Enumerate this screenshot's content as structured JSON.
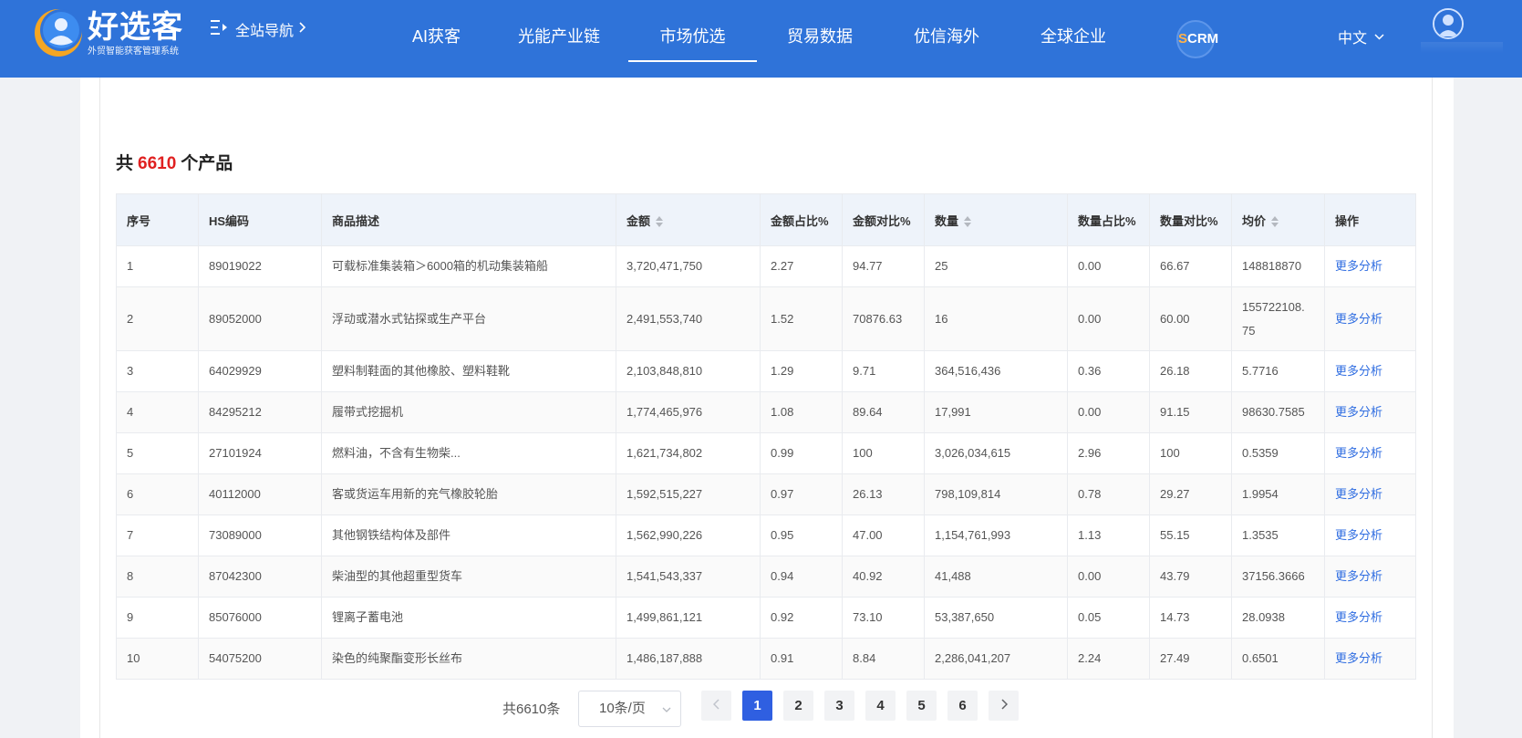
{
  "header": {
    "logo_name": "好选客",
    "logo_sub": "外贸智能获客管理系统",
    "site_nav": "全站导航",
    "nav": [
      {
        "label": "AI获客",
        "active": false
      },
      {
        "label": "光能产业链",
        "active": false
      },
      {
        "label": "市场优选",
        "active": true
      },
      {
        "label": "贸易数据",
        "active": false
      },
      {
        "label": "优信海外",
        "active": false
      },
      {
        "label": "全球企业",
        "active": false
      }
    ],
    "scrm_first": "S",
    "scrm_rest": "CRM",
    "language": "中文"
  },
  "summary": {
    "prefix": "共",
    "count": "6610",
    "suffix": "个产品"
  },
  "table": {
    "columns": [
      "序号",
      "HS编码",
      "商品描述",
      "金额",
      "金额占比%",
      "金额对比%",
      "数量",
      "数量占比%",
      "数量对比%",
      "均价",
      "操作"
    ],
    "rows": [
      {
        "no": "1",
        "hs": "89019022",
        "desc": "可载标准集装箱＞6000箱的机动集装箱船",
        "amount": "3,720,471,750",
        "amount_pct": "2.27",
        "amount_cmp": "94.77",
        "qty": "25",
        "qty_pct": "0.00",
        "qty_cmp": "66.67",
        "avg": "148818870",
        "action": "更多分析"
      },
      {
        "no": "2",
        "hs": "89052000",
        "desc": "浮动或潜水式钻探或生产平台",
        "amount": "2,491,553,740",
        "amount_pct": "1.52",
        "amount_cmp": "70876.63",
        "qty": "16",
        "qty_pct": "0.00",
        "qty_cmp": "60.00",
        "avg_line1": "155722108.",
        "avg_line2": "75",
        "action": "更多分析"
      },
      {
        "no": "3",
        "hs": "64029929",
        "desc": "塑料制鞋面的其他橡胶、塑料鞋靴",
        "amount": "2,103,848,810",
        "amount_pct": "1.29",
        "amount_cmp": "9.71",
        "qty": "364,516,436",
        "qty_pct": "0.36",
        "qty_cmp": "26.18",
        "avg": "5.7716",
        "action": "更多分析"
      },
      {
        "no": "4",
        "hs": "84295212",
        "desc": "履带式挖掘机",
        "amount": "1,774,465,976",
        "amount_pct": "1.08",
        "amount_cmp": "89.64",
        "qty": "17,991",
        "qty_pct": "0.00",
        "qty_cmp": "91.15",
        "avg": "98630.7585",
        "action": "更多分析"
      },
      {
        "no": "5",
        "hs": "27101924",
        "desc": "燃料油，不含有生物柴...",
        "amount": "1,621,734,802",
        "amount_pct": "0.99",
        "amount_cmp": "100",
        "qty": "3,026,034,615",
        "qty_pct": "2.96",
        "qty_cmp": "100",
        "avg": "0.5359",
        "action": "更多分析"
      },
      {
        "no": "6",
        "hs": "40112000",
        "desc": "客或货运车用新的充气橡胶轮胎",
        "amount": "1,592,515,227",
        "amount_pct": "0.97",
        "amount_cmp": "26.13",
        "qty": "798,109,814",
        "qty_pct": "0.78",
        "qty_cmp": "29.27",
        "avg": "1.9954",
        "action": "更多分析"
      },
      {
        "no": "7",
        "hs": "73089000",
        "desc": "其他钢铁结构体及部件",
        "amount": "1,562,990,226",
        "amount_pct": "0.95",
        "amount_cmp": "47.00",
        "qty": "1,154,761,993",
        "qty_pct": "1.13",
        "qty_cmp": "55.15",
        "avg": "1.3535",
        "action": "更多分析"
      },
      {
        "no": "8",
        "hs": "87042300",
        "desc": "柴油型的其他超重型货车",
        "amount": "1,541,543,337",
        "amount_pct": "0.94",
        "amount_cmp": "40.92",
        "qty": "41,488",
        "qty_pct": "0.00",
        "qty_cmp": "43.79",
        "avg": "37156.3666",
        "action": "更多分析"
      },
      {
        "no": "9",
        "hs": "85076000",
        "desc": "锂离子蓄电池",
        "amount": "1,499,861,121",
        "amount_pct": "0.92",
        "amount_cmp": "73.10",
        "qty": "53,387,650",
        "qty_pct": "0.05",
        "qty_cmp": "14.73",
        "avg": "28.0938",
        "action": "更多分析"
      },
      {
        "no": "10",
        "hs": "54075200",
        "desc": "染色的纯聚酯变形长丝布",
        "amount": "1,486,187,888",
        "amount_pct": "0.91",
        "amount_cmp": "8.84",
        "qty": "2,286,041,207",
        "qty_pct": "2.24",
        "qty_cmp": "27.49",
        "avg": "0.6501",
        "action": "更多分析"
      }
    ]
  },
  "pagination": {
    "total": "共6610条",
    "page_size": "10条/页",
    "pages": [
      "1",
      "2",
      "3",
      "4",
      "5",
      "6"
    ],
    "current": "1"
  },
  "colors": {
    "header_bg": "#2f73d9",
    "accent": "#2f5fe1",
    "count_red": "#e02020",
    "link": "#2f6de1"
  },
  "icons": [
    "logo-icon",
    "menu-icon",
    "chevron-right-icon",
    "chevron-down-icon",
    "user-avatar-icon",
    "sort-icon",
    "prev-page-icon",
    "next-page-icon"
  ]
}
